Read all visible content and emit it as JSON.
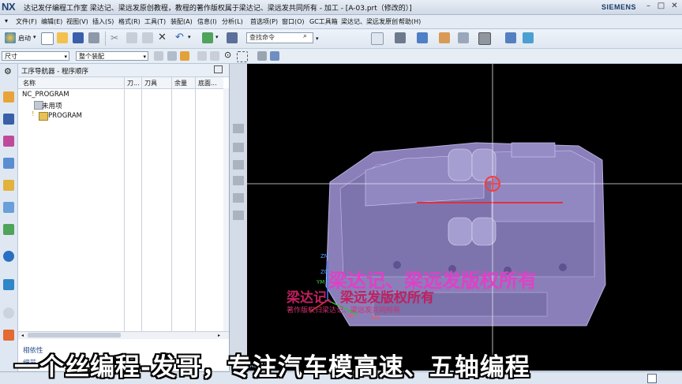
{
  "window": {
    "logo": "NX",
    "title": "达记发仔编程工作室  梁达记、梁远发原创教程，教程的著作版权属于梁达记、梁远发共同所有 - 加工 - [A-03.prt（修改的）]",
    "brand": "SIEMENS"
  },
  "menu": [
    "文件(F)",
    "编辑(E)",
    "视图(V)",
    "插入(S)",
    "格式(R)",
    "工具(T)",
    "装配(A)",
    "信息(I)",
    "分析(L)",
    "首选项(P)",
    "窗口(O)",
    "GC工具箱",
    "梁达记、梁远发原创",
    "帮助(H)"
  ],
  "toolbar": {
    "start_label": "启动",
    "command_search_placeholder": "查找命令"
  },
  "selectors": {
    "filter": "尺寸",
    "scope": "整个装配"
  },
  "navigator": {
    "title": "工序导航器 - 程序顺序",
    "columns": [
      "名称",
      "刀...",
      "刀具",
      "余量",
      "底面..."
    ],
    "rows": [
      {
        "label": "NC_PROGRAM"
      },
      {
        "label": "未用项"
      },
      {
        "label": "PROGRAM"
      }
    ],
    "bottom_tabs": [
      "相依性",
      "细节"
    ]
  },
  "viewport": {
    "axis_labels": {
      "zm": "ZM",
      "zc": "ZC",
      "ym": "YM",
      "xc": "XC",
      "xm": "XM"
    },
    "watermark_main": "梁达记、梁远发版权所有",
    "watermark_sub": "梁达记、梁远发版权所有",
    "watermark_copyright": "著作版权归梁达记、梁远发共同所有",
    "status_left": "XC_NC_",
    "colors": {
      "part": "#8a7fb8",
      "watermark": "#e040c8",
      "background": "#000000"
    }
  },
  "subtitle": "一个丝编程-发哥，专注汽车模高速、五轴编程"
}
